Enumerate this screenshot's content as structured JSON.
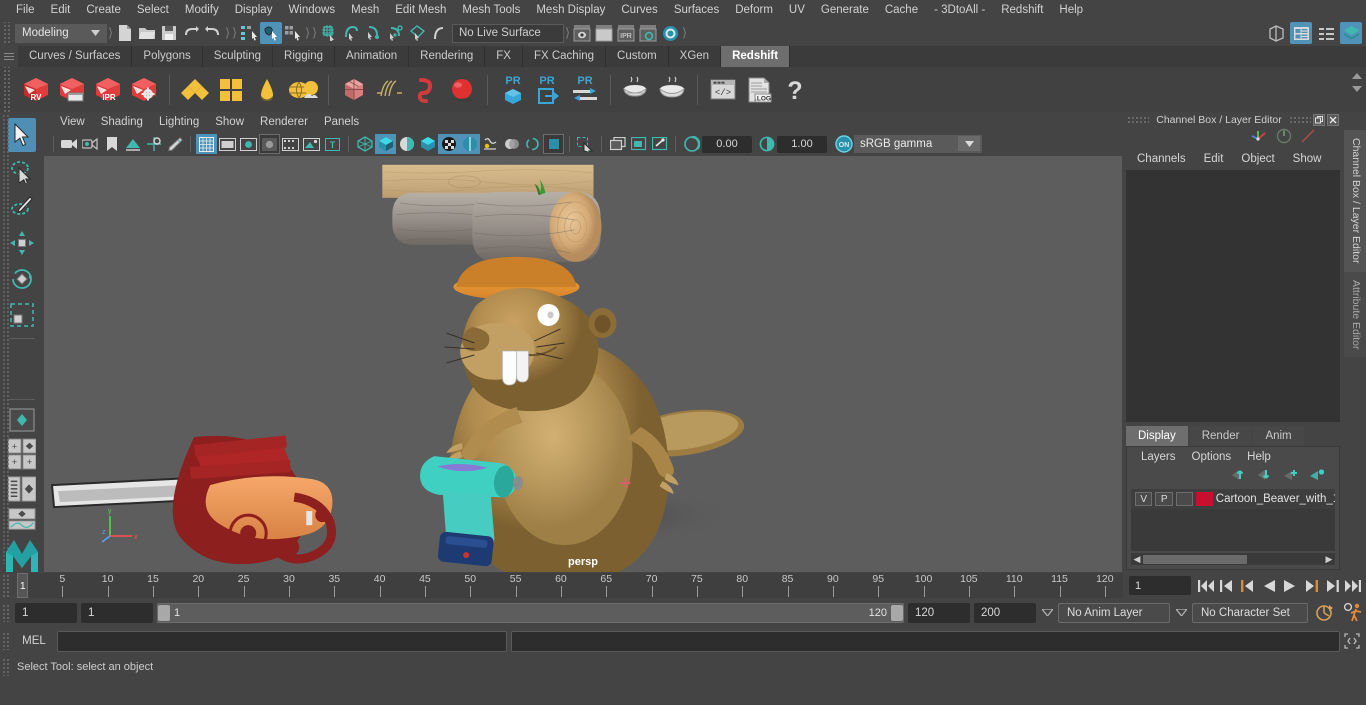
{
  "menubar": {
    "items": [
      "File",
      "Edit",
      "Create",
      "Select",
      "Modify",
      "Display",
      "Windows",
      "Mesh",
      "Edit Mesh",
      "Mesh Tools",
      "Mesh Display",
      "Curves",
      "Surfaces",
      "Deform",
      "UV",
      "Generate",
      "Cache",
      "- 3DtoAll -",
      "Redshift",
      "Help"
    ]
  },
  "statusbar": {
    "mode": "Modeling",
    "live_surface": "No Live Surface",
    "icons": [
      "new-scene-icon",
      "open-scene-icon",
      "save-scene-icon",
      "undo-icon",
      "redo-icon",
      "select-hierarchy-icon",
      "select-object-icon",
      "select-component-icon",
      "snap-grid-icon",
      "snap-curve-icon",
      "snap-point-icon",
      "snap-projected-center-icon",
      "snap-view-plane-icon",
      "make-live-icon",
      "render-view-icon",
      "render-current-frame-icon",
      "ipr-render-icon",
      "render-settings-icon",
      "hypershade-icon"
    ],
    "right_icons": [
      "sidebar-toggle-icon",
      "attribute-editor-icon",
      "tool-settings-icon",
      "channel-box-icon"
    ]
  },
  "shelf": {
    "tabs": [
      "Curves / Surfaces",
      "Polygons",
      "Sculpting",
      "Rigging",
      "Animation",
      "Rendering",
      "FX",
      "FX Caching",
      "Custom",
      "XGen",
      "Redshift"
    ],
    "active_tab": "Redshift",
    "icons": [
      {
        "name": "redshift-render-view-icon",
        "label": "RV"
      },
      {
        "name": "redshift-render-sequence-icon",
        "label": ""
      },
      {
        "name": "redshift-ipr-icon",
        "label": "IPR"
      },
      {
        "name": "redshift-render-settings-icon",
        "label": ""
      },
      {
        "name": "redshift-material-icon",
        "label": ""
      },
      {
        "name": "redshift-texture-icon",
        "label": ""
      },
      {
        "name": "redshift-dome-light-icon",
        "label": ""
      },
      {
        "name": "redshift-environment-icon",
        "label": ""
      },
      {
        "name": "redshift-proxy-icon",
        "label": ""
      },
      {
        "name": "redshift-hair-icon",
        "label": ""
      },
      {
        "name": "redshift-volume-icon",
        "label": ""
      },
      {
        "name": "redshift-sphere-icon",
        "label": ""
      },
      {
        "name": "redshift-pr-object-icon",
        "label": "PR"
      },
      {
        "name": "redshift-pr-export-icon",
        "label": "PR"
      },
      {
        "name": "redshift-pr-transfer-icon",
        "label": "PR"
      },
      {
        "name": "redshift-bake-icon",
        "label": ""
      },
      {
        "name": "redshift-bake-set-icon",
        "label": ""
      },
      {
        "name": "redshift-script-icon",
        "label": ""
      },
      {
        "name": "redshift-log-icon",
        "label": ".LOG"
      },
      {
        "name": "redshift-help-icon",
        "label": "?"
      }
    ]
  },
  "toolbox": {
    "items": [
      {
        "name": "select-tool",
        "selected": true
      },
      {
        "name": "lasso-select-tool",
        "selected": false
      },
      {
        "name": "paint-select-tool",
        "selected": false
      },
      {
        "name": "move-tool",
        "selected": false
      },
      {
        "name": "rotate-tool",
        "selected": false
      },
      {
        "name": "scale-tool",
        "selected": false
      },
      {
        "name": "last-tool-used",
        "selected": false
      }
    ],
    "layout_items": [
      {
        "name": "single-perspective-layout"
      },
      {
        "name": "four-view-layout"
      },
      {
        "name": "outliner-persp-layout"
      },
      {
        "name": "persp-graph-layout"
      }
    ],
    "logo": "maya-logo-icon"
  },
  "viewport": {
    "menu": [
      "View",
      "Shading",
      "Lighting",
      "Show",
      "Renderer",
      "Panels"
    ],
    "camera_label": "persp",
    "exposure": "0.00",
    "gamma": "1.00",
    "color_management": "sRGB gamma",
    "color_management_enabled": "ON",
    "toolbar_icons": [
      "camera-select-icon",
      "camera-attributes-icon",
      "bookmark-icon",
      "image-plane-icon",
      "two-d-pan-zoom-icon",
      "grease-pencil-icon",
      "grid-toggle-icon",
      "film-gate-icon",
      "resolution-gate-icon",
      "gate-mask-icon",
      "film-origin-icon",
      "xray-icon",
      "xray-joints-icon",
      "wireframe-shaded-icon",
      "smooth-shade-all-icon",
      "shade-textured-icon",
      "use-all-lights-icon",
      "shadows-icon",
      "screen-space-ao-icon",
      "motion-blur-icon",
      "multisample-icon",
      "depth-of-field-icon",
      "isolate-select-icon",
      "paint-effects-icon",
      "display-fluids-icon",
      "xray-toggle-icon",
      "exposure-icon",
      "gamma-icon"
    ],
    "scene_objects": [
      "wooden-plank",
      "log-pair",
      "cartoon-beaver",
      "hard-hat",
      "chainsaw",
      "power-drill",
      "shadow-plane"
    ]
  },
  "right_dock": {
    "title": "Channel Box / Layer Editor",
    "channel_menu": [
      "Channels",
      "Edit",
      "Object",
      "Show"
    ],
    "gizmo_icons": [
      "axis-gizmo-icon",
      "dial-gizmo-icon",
      "slider-gizmo-icon"
    ],
    "layer_tabs": [
      "Display",
      "Render",
      "Anim"
    ],
    "layer_active_tab": "Display",
    "layer_menu": [
      "Layers",
      "Options",
      "Help"
    ],
    "layer_buttons": [
      "move-layer-up-icon",
      "move-layer-down-icon",
      "create-layer-icon",
      "create-layer-from-selected-icon"
    ],
    "layers": [
      {
        "visibility": "V",
        "playback": "P",
        "shading": "",
        "color": "#c8102e",
        "name": "Cartoon_Beaver_with_1"
      }
    ],
    "vertical_tabs": [
      "Channel Box / Layer Editor",
      "Attribute Editor"
    ]
  },
  "time_slider": {
    "ticks": [
      5,
      10,
      15,
      20,
      25,
      30,
      35,
      40,
      45,
      50,
      55,
      60,
      65,
      70,
      75,
      80,
      85,
      90,
      95,
      100,
      105,
      110,
      115,
      120
    ],
    "current_frame_marker": "1",
    "current_frame_field": "1",
    "playback_buttons": [
      "go-to-start-icon",
      "step-back-keyframe-icon",
      "step-back-frame-icon",
      "play-backwards-icon",
      "play-forwards-icon",
      "step-forward-frame-icon",
      "step-forward-keyframe-icon",
      "go-to-end-icon"
    ]
  },
  "range_slider": {
    "start_field": "1",
    "anim_start_field": "1",
    "range_start_label": "1",
    "range_end_label": "120",
    "anim_end_field": "120",
    "end_field": "200",
    "anim_layer": "No Anim Layer",
    "character_set": "No Character Set",
    "right_icons": [
      "auto-keyframe-icon",
      "animation-preferences-icon"
    ]
  },
  "command_line": {
    "label": "MEL",
    "input_value": "",
    "output_value": "",
    "script-editor-icon": "script-editor-icon"
  },
  "status_line": {
    "message": "Select Tool: select an object"
  }
}
